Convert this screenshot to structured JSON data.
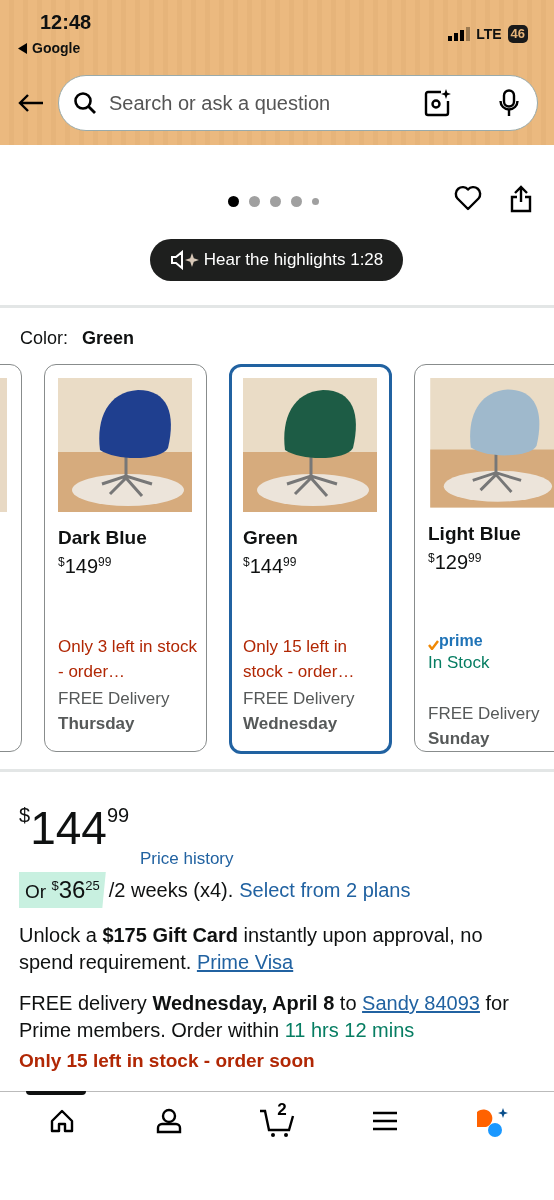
{
  "status_bar": {
    "time": "12:48",
    "back_app": "Google",
    "network": "LTE",
    "battery": "46"
  },
  "search": {
    "placeholder": "Search or ask a question"
  },
  "gallery": {
    "pages": [
      {
        "selected": true
      },
      {
        "selected": false
      },
      {
        "selected": false
      },
      {
        "selected": false
      },
      {
        "selected": false
      }
    ]
  },
  "audio_button": {
    "label": "Hear the highlights 1:28"
  },
  "color_picker": {
    "label": "Color:",
    "value": "Green",
    "options": [
      {
        "name": "Dark Blue",
        "currency": "$",
        "price_whole": "149",
        "price_fraction": "99",
        "availability": "Only 3 left in stock - order…",
        "kind": "low_stock",
        "delivery": "FREE Delivery",
        "day": "Thursday",
        "selected": false,
        "color": "#1f3f8f"
      },
      {
        "name": "Green",
        "currency": "$",
        "price_whole": "144",
        "price_fraction": "99",
        "availability": "Only 15 left in stock - order…",
        "kind": "low_stock",
        "delivery": "FREE Delivery",
        "day": "Wednesday",
        "selected": true,
        "color": "#1d5c45"
      },
      {
        "name": "Light Blue",
        "currency": "$",
        "price_whole": "129",
        "price_fraction": "99",
        "prime_badge": "prime",
        "availability": "In Stock",
        "kind": "in_stock",
        "delivery": "FREE Delivery",
        "day": "Sunday",
        "selected": false,
        "color": "#9fb9cc"
      }
    ]
  },
  "price": {
    "currency": "$",
    "whole": "144",
    "fraction": "99",
    "history_link": "Price history"
  },
  "installments": {
    "prefix": "Or",
    "currency": "$",
    "whole": "36",
    "fraction": "25",
    "suffix": "/2 weeks (x4).",
    "link": "Select from 2 plans"
  },
  "gift_offer": {
    "text": "Unlock a **$175 Gift Card** instantly upon approval, no spend requirement.",
    "link": "Prime Visa"
  },
  "delivery": {
    "text": "FREE delivery **Wednesday, April 8** to",
    "link": "Sandy 84093",
    "text_after": "for Prime members. Order within",
    "countdown": "11 hrs 12 mins"
  },
  "low_stock": "Only 15 left in stock - order soon",
  "tab_bar": {
    "tabs": [
      {
        "kind": "home",
        "selected": true
      },
      {
        "kind": "account",
        "selected": false
      },
      {
        "kind": "cart",
        "badge": "2",
        "selected": false
      },
      {
        "kind": "menu",
        "selected": false
      },
      {
        "kind": "assistant",
        "selected": false
      }
    ]
  }
}
